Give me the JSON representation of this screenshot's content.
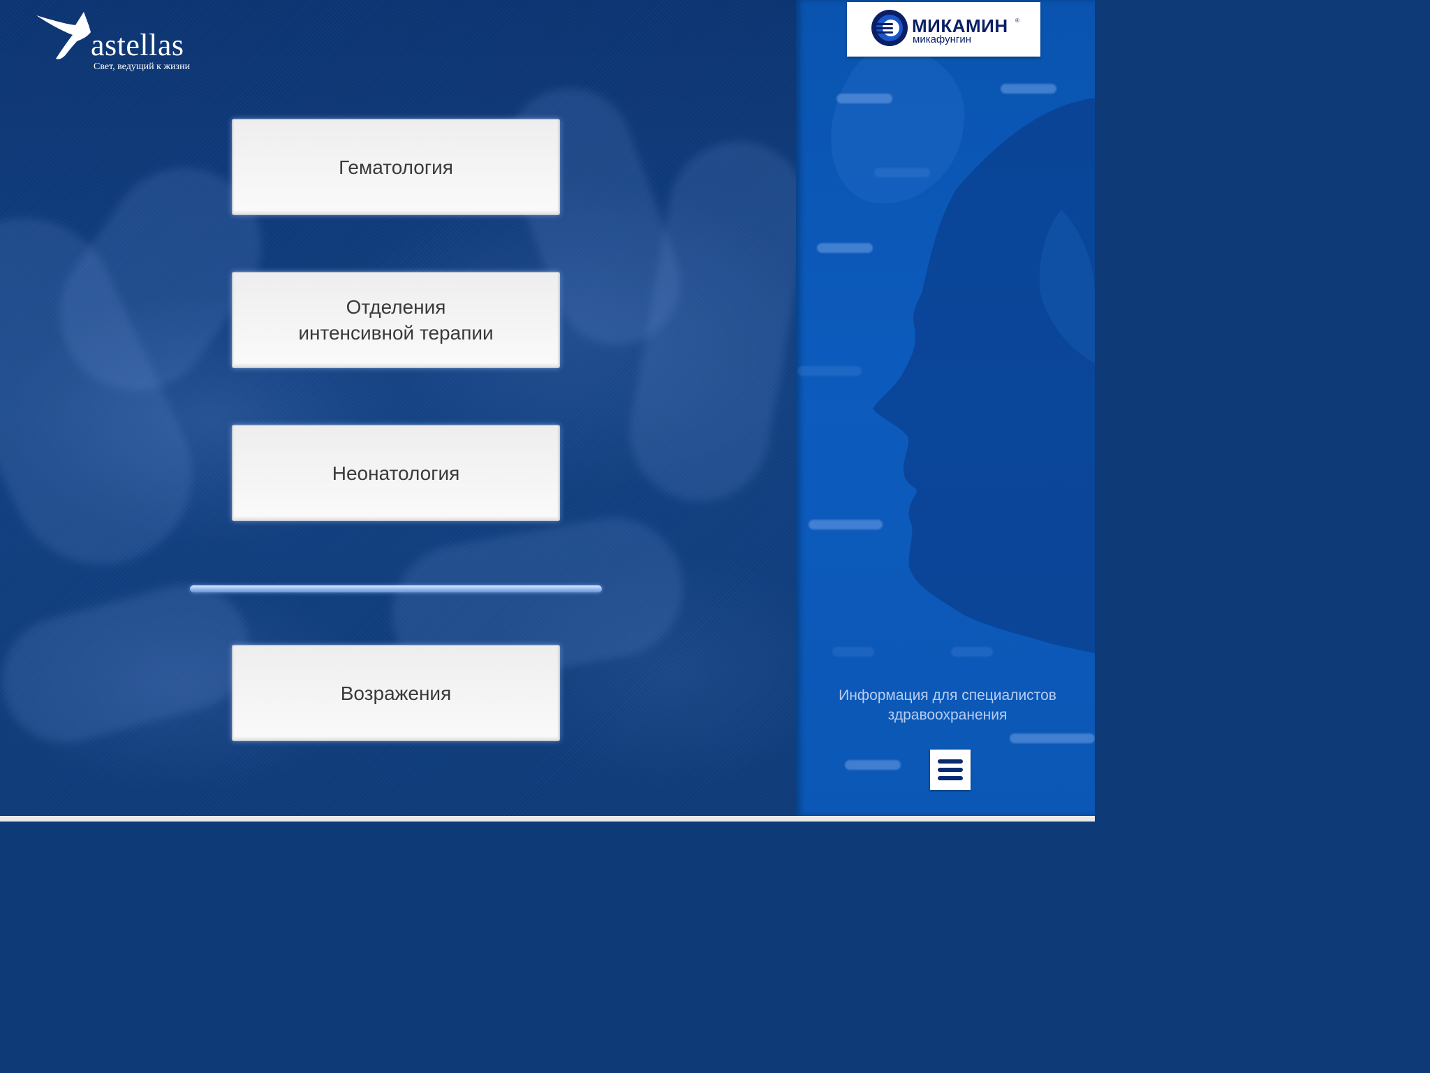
{
  "company": {
    "name": "astellas",
    "tagline": "Свет, ведущий к жизни"
  },
  "menu": {
    "items": [
      {
        "id": "hematology",
        "label": "Гематология"
      },
      {
        "id": "icu",
        "label": "Отделения\nинтенсивной терапии"
      },
      {
        "id": "neonatology",
        "label": "Неонатология"
      }
    ],
    "objections": {
      "label": "Возражения"
    }
  },
  "product": {
    "name": "МИКАМИН",
    "registered": "®",
    "generic": "микафунгин"
  },
  "info_text": "Информация для специалистов\nздравоохранения",
  "icons": {
    "logo_star": "star-icon",
    "product_mark": "micamine-logo-icon",
    "menu": "hamburger-icon"
  },
  "colors": {
    "left_bg": "#0f3b79",
    "right_bg": "#0b57b5",
    "button_text": "#3a3a3a",
    "brand_navy": "#0a1f66",
    "info_text": "#b8cdf0"
  }
}
